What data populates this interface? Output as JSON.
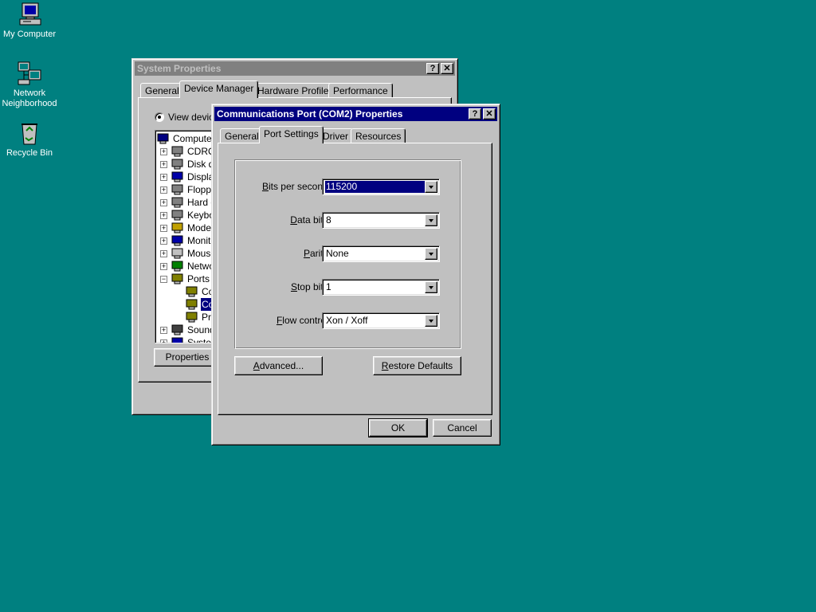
{
  "desktop": {
    "icons": [
      {
        "label": "My Computer"
      },
      {
        "label": "Network Neighborhood"
      },
      {
        "label": "Recycle Bin"
      }
    ]
  },
  "system_properties": {
    "title": "System Properties",
    "tabs": [
      "General",
      "Device Manager",
      "Hardware Profiles",
      "Performance"
    ],
    "selected_tab": "Device Manager",
    "view_option": "View device",
    "tree": [
      {
        "label": "Computer",
        "icon": "computer-icon",
        "level": 0
      },
      {
        "label": "CDRO",
        "icon": "cdrom-icon",
        "level": 1,
        "expander": "+"
      },
      {
        "label": "Disk d",
        "icon": "disk-icon",
        "level": 1,
        "expander": "+"
      },
      {
        "label": "Displa",
        "icon": "display-icon",
        "level": 1,
        "expander": "+"
      },
      {
        "label": "Floppy",
        "icon": "floppy-icon",
        "level": 1,
        "expander": "+"
      },
      {
        "label": "Hard d",
        "icon": "harddisk-icon",
        "level": 1,
        "expander": "+"
      },
      {
        "label": "Keybo",
        "icon": "keyboard-icon",
        "level": 1,
        "expander": "+"
      },
      {
        "label": "Moder",
        "icon": "modem-icon",
        "level": 1,
        "expander": "+"
      },
      {
        "label": "Monito",
        "icon": "monitor-icon",
        "level": 1,
        "expander": "+"
      },
      {
        "label": "Mouse",
        "icon": "mouse-icon",
        "level": 1,
        "expander": "+"
      },
      {
        "label": "Netwo",
        "icon": "network-icon",
        "level": 1,
        "expander": "+"
      },
      {
        "label": "Ports (",
        "icon": "port-icon",
        "level": 1,
        "expander": "−"
      },
      {
        "label": "Co",
        "icon": "port-icon",
        "level": 2
      },
      {
        "label": "Co",
        "icon": "port-icon",
        "level": 2,
        "selected": true
      },
      {
        "label": "Pr",
        "icon": "port-icon",
        "level": 2
      },
      {
        "label": "Sound",
        "icon": "sound-icon",
        "level": 1,
        "expander": "+"
      },
      {
        "label": "Systen",
        "icon": "system-icon",
        "level": 1,
        "expander": "+"
      }
    ],
    "properties_button": "Properties"
  },
  "com_dialog": {
    "title": "Communications Port (COM2) Properties",
    "tabs": [
      "General",
      "Port Settings",
      "Driver",
      "Resources"
    ],
    "selected_tab": "Port Settings",
    "fields": [
      {
        "label": "Bits per second:",
        "value": "115200",
        "focused": true
      },
      {
        "label": "Data bits:",
        "value": "8"
      },
      {
        "label": "Parity:",
        "value": "None"
      },
      {
        "label": "Stop bits:",
        "value": "1"
      },
      {
        "label": "Flow control:",
        "value": "Xon / Xoff"
      }
    ],
    "advanced_button": "Advanced...",
    "restore_button": "Restore Defaults",
    "ok_button": "OK",
    "cancel_button": "Cancel",
    "help_button": "?",
    "close_button": "✕"
  },
  "colors": {
    "desktop": "#008080",
    "face": "#c0c0c0",
    "active_title": "#000080",
    "inactive_title": "#808080",
    "selection": "#000080"
  }
}
